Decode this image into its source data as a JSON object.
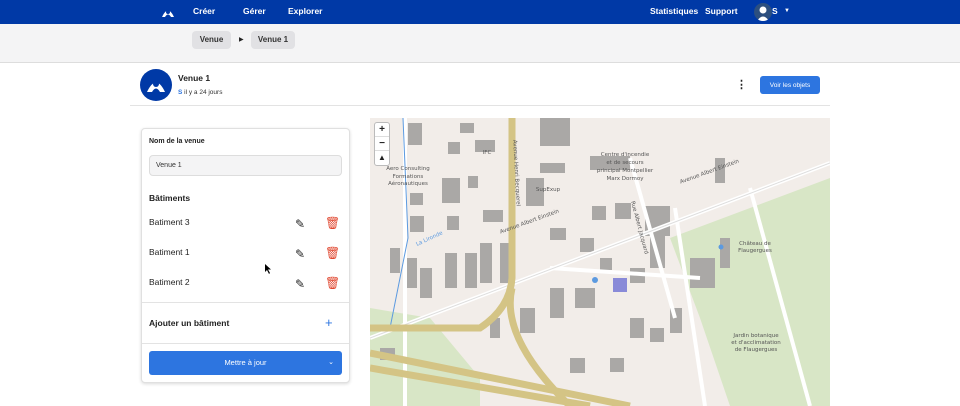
{
  "topbar": {
    "nav": [
      "Créer",
      "Gérer",
      "Explorer"
    ],
    "right": [
      "Statistiques",
      "Support"
    ],
    "user": "S"
  },
  "breadcrumb": [
    "Venue",
    "Venue 1"
  ],
  "header": {
    "title": "Venue 1",
    "user": "S",
    "time": "il y a 24 jours",
    "button": "Voir les objets"
  },
  "panel": {
    "name_label": "Nom de la venue",
    "name_value": "Venue 1",
    "buildings_label": "Bâtiments",
    "buildings": [
      "Batiment 3",
      "Batiment 1",
      "Batiment 2"
    ],
    "add_label": "Ajouter un bâtiment",
    "update_label": "Mettre à jour"
  },
  "map": {
    "zoom_in": "+",
    "zoom_out": "−",
    "labels": {
      "ifc": "IFC",
      "aero": [
        "Aero Consulting",
        "Formations",
        "Aéronautiques"
      ],
      "fire": [
        "Centre d'incendie",
        "et de secours",
        "principal Montpellier",
        "Marx Dormoy"
      ],
      "supexup": "SupExup",
      "einstein": "Avenue Albert Einstein",
      "becquerel": "Avenue Henri Becquerel",
      "jacquard": "Rue Albert Jacquard",
      "chateau": [
        "Château de",
        "Flaugergues"
      ],
      "jardin": [
        "Jardin botanique",
        "et d'acclimatation",
        "de Flaugergues"
      ],
      "lironde": "La Lironde"
    }
  },
  "colors": {
    "brand": "#0039a6",
    "primary": "#2d75e0",
    "danger": "#e0442c"
  }
}
